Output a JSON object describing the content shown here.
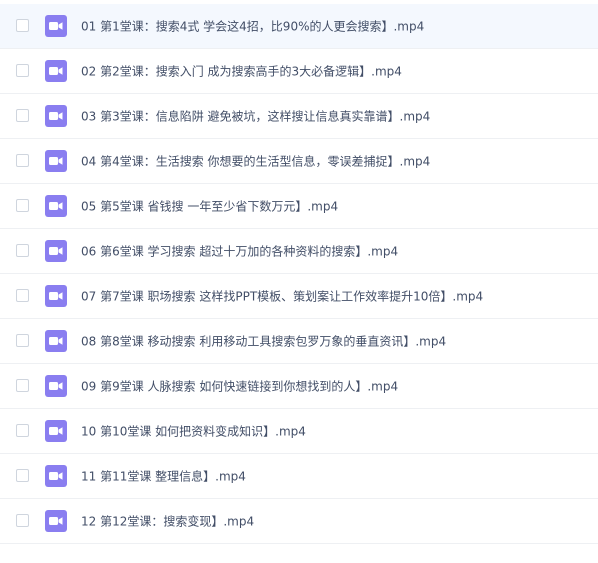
{
  "files": [
    {
      "name": "01 第1堂课：搜索4式 学会这4招，比90%的人更会搜索】.mp4",
      "icon": "video-file-icon",
      "hovered": true
    },
    {
      "name": "02 第2堂课：搜索入门 成为搜索高手的3大必备逻辑】.mp4",
      "icon": "video-file-icon",
      "hovered": false
    },
    {
      "name": "03 第3堂课：信息陷阱 避免被坑，这样搜让信息真实靠谱】.mp4",
      "icon": "video-file-icon",
      "hovered": false
    },
    {
      "name": "04 第4堂课：生活搜索 你想要的生活型信息，零误差捕捉】.mp4",
      "icon": "video-file-icon",
      "hovered": false
    },
    {
      "name": "05 第5堂课 省钱搜 一年至少省下数万元】.mp4",
      "icon": "video-file-icon",
      "hovered": false
    },
    {
      "name": "06 第6堂课 学习搜索 超过十万加的各种资料的搜索】.mp4",
      "icon": "video-file-icon",
      "hovered": false
    },
    {
      "name": "07 第7堂课 职场搜索 这样找PPT模板、策划案让工作效率提升10倍】.mp4",
      "icon": "video-file-icon",
      "hovered": false
    },
    {
      "name": "08 第8堂课 移动搜索 利用移动工具搜索包罗万象的垂直资讯】.mp4",
      "icon": "video-file-icon",
      "hovered": false
    },
    {
      "name": "09 第9堂课 人脉搜索 如何快速链接到你想找到的人】.mp4",
      "icon": "video-file-icon",
      "hovered": false
    },
    {
      "name": "10 第10堂课 如何把资料变成知识】.mp4",
      "icon": "video-file-icon",
      "hovered": false
    },
    {
      "name": "11 第11堂课 整理信息】.mp4",
      "icon": "video-file-icon",
      "hovered": false
    },
    {
      "name": "12 第12堂课：搜索变现】.mp4",
      "icon": "video-file-icon",
      "hovered": false
    }
  ],
  "colors": {
    "icon_bg": "#8a7ef0",
    "text": "#424e67",
    "row_hover": "#f4f8fe",
    "divider": "#eef0f3"
  }
}
